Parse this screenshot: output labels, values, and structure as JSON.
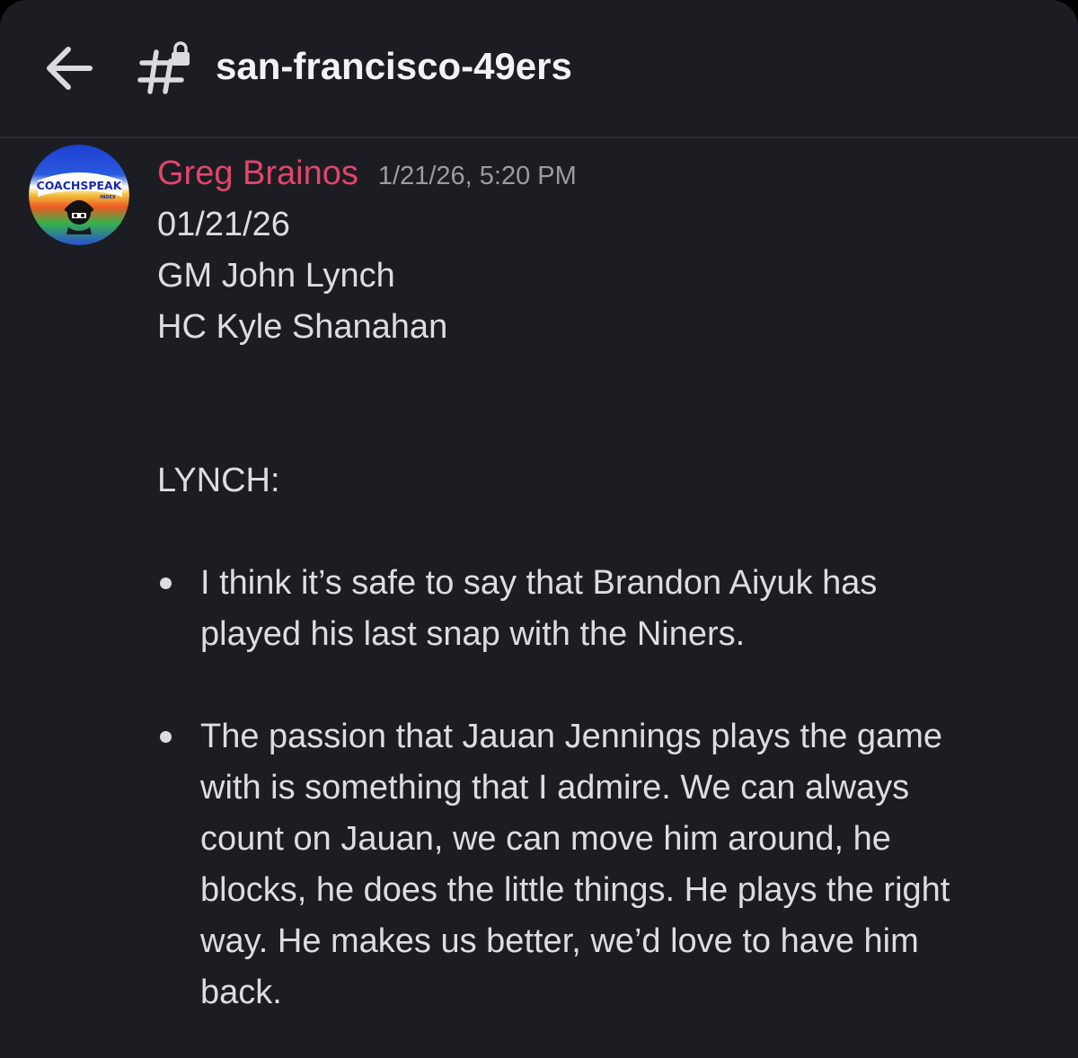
{
  "header": {
    "channel_name": "san-francisco-49ers",
    "back_icon": "arrow-left-icon",
    "channel_icon": "locked-hashtag-icon"
  },
  "message": {
    "author": "Greg Brainos",
    "author_color": "#e2456b",
    "timestamp": "1/21/26, 5:20 PM",
    "avatar": {
      "text_main": "COACHSPEAK",
      "text_sub": "INDEX"
    },
    "lines": [
      "01/21/26",
      "GM John Lynch",
      "HC Kyle Shanahan"
    ],
    "section_heading": "LYNCH:",
    "bullets": [
      {
        "lines": [
          "I think it’s safe to say that Brandon Aiyuk has",
          "played his last snap with the Niners."
        ]
      },
      {
        "lines": [
          "The passion that Jauan Jennings plays the game",
          "with is something that I admire. We can always",
          "count on Jauan, we can move him around, he",
          "blocks, he does the little things. He plays the right",
          "way. He makes us better, we’d love to have him",
          "back."
        ]
      }
    ]
  },
  "colors": {
    "background": "#1c1d22",
    "text": "#dcdde2",
    "muted": "#9a9ca4",
    "title": "#f2f3f5"
  }
}
